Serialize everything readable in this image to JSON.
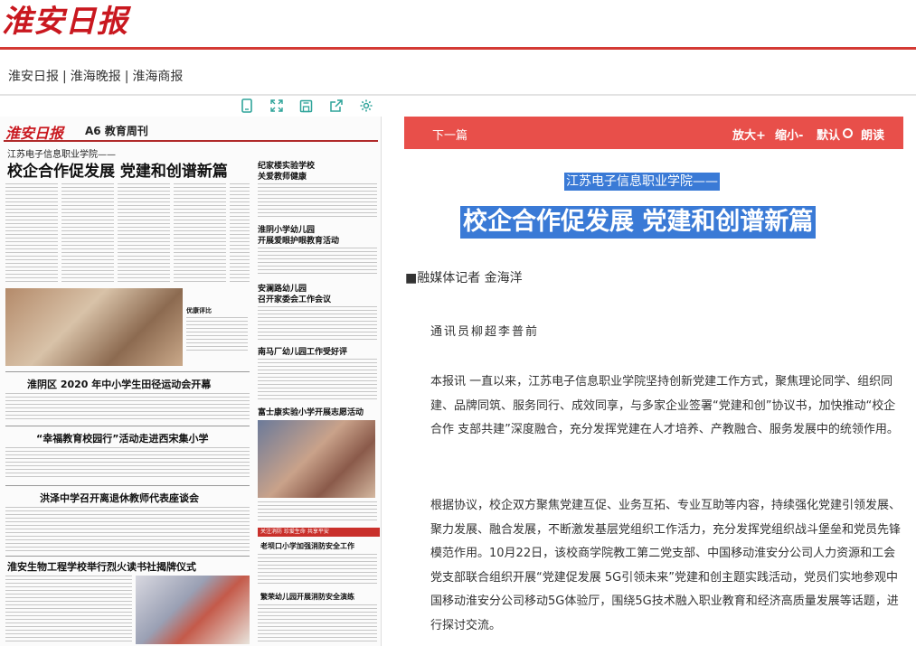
{
  "site": {
    "logo": "淮安日报"
  },
  "nav": {
    "items": [
      "淮安日报",
      "淮海晚报",
      "淮海商报"
    ],
    "separator": "|"
  },
  "toolbar": {
    "icons": [
      "single-page-icon",
      "expand-icon",
      "save-icon",
      "share-icon",
      "settings-icon"
    ]
  },
  "paper": {
    "logo": "淮安日报",
    "edition": "A6 教育周刊",
    "kicker": "江苏电子信息职业学院——",
    "title": "校企合作促发展  党建和创谱新篇",
    "headlines": {
      "h1": "纪家楼实验学校",
      "h1b": "关爱教师健康",
      "h2": "淮阴小学幼儿园",
      "h2b": "开展爱眼护眼教育活动",
      "h3": "安澜路幼儿园",
      "h3b": "召开家委会工作会议",
      "h4": "南马厂幼儿园工作受好评",
      "h5": "淮阴区 2020 年中小学生田径运动会开幕",
      "h6": "“幸福教育校园行”活动走进西宋集小学",
      "h7": "富士康实验小学开展志愿活动",
      "h8": "洪泽中学召开离退休教师代表座谈会",
      "h9": "老坝口小学加强消防安全工作",
      "h10": "淮安生物工程学校举行烈火读书社揭牌仪式",
      "h11": "繁荣幼儿园开展消防安全演练",
      "caption": "优康评比",
      "redbox": "关注消防  珍爱生命  共享平安"
    }
  },
  "reader": {
    "next": "下一篇",
    "zoom_in": "放大+",
    "zoom_out": "缩小-",
    "default": "默认",
    "read": "朗读"
  },
  "article": {
    "subtitle": "江苏电子信息职业学院——",
    "title": "校企合作促发展 党建和创谱新篇",
    "author": "■融媒体记者 金海洋",
    "correspondents": "通讯员柳超李普前",
    "paragraphs": [
      "本报讯 一直以来，江苏电子信息职业学院坚持创新党建工作方式，聚焦理论同学、组织同建、品牌同筑、服务同行、成效同享，与多家企业签署“党建和创”协议书，加快推动“校企合作 支部共建”深度融合，充分发挥党建在人才培养、产教融合、服务发展中的统领作用。",
      "根据协议，校企双方聚焦党建互促、业务互拓、专业互助等内容，持续强化党建引领发展、聚力发展、融合发展，不断激发基层党组织工作活力，充分发挥党组织战斗堡垒和党员先锋模范作用。10月22日，该校商学院教工第二党支部、中国移动淮安分公司人力资源和工会党支部联合组织开展“党建促发展 5G引领未来”党建和创主题实践活动，党员们实地参观中国移动淮安分公司移动5G体验厅，围绕5G技术融入职业教育和经济高质量发展等话题，进行探讨交流。"
    ]
  },
  "colors": {
    "brand_red": "#d43a34",
    "reader_bar": "#e84f4a",
    "highlight": "#3a7ad6",
    "tool": "#2fa49a"
  }
}
